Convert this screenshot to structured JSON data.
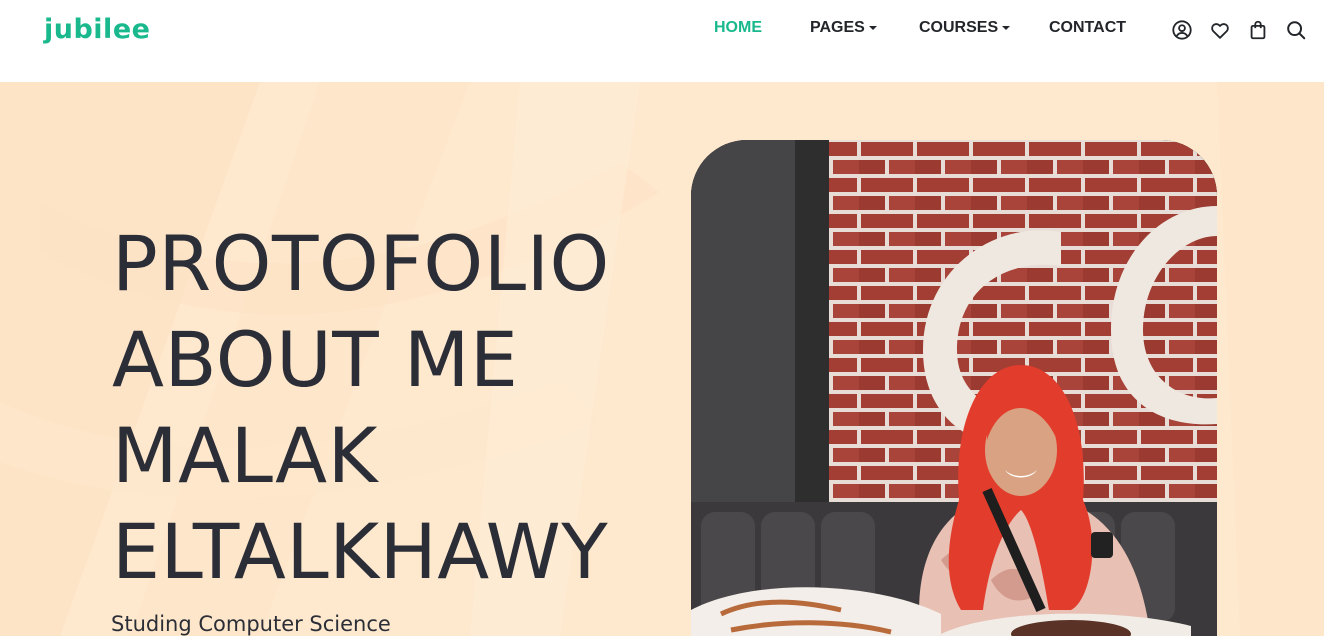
{
  "brand": {
    "logo_text": "jubilee",
    "accent": "#1ab88d"
  },
  "nav": {
    "items": [
      {
        "label": "HOME",
        "active": true,
        "dropdown": false
      },
      {
        "label": "PAGES",
        "active": false,
        "dropdown": true
      },
      {
        "label": "COURSES",
        "active": false,
        "dropdown": true
      },
      {
        "label": "CONTACT",
        "active": false,
        "dropdown": false
      }
    ],
    "icons": [
      "user-circle-icon",
      "heart-icon",
      "shopping-bag-icon",
      "search-icon"
    ]
  },
  "hero": {
    "title_lines": [
      "PROTOFOLIO",
      "ABOUT ME",
      "MALAK",
      "ELTALKHAWY"
    ],
    "subtitle": "Studing Computer Science",
    "background_color": "#fee9cf",
    "text_color": "#2b2e37"
  }
}
